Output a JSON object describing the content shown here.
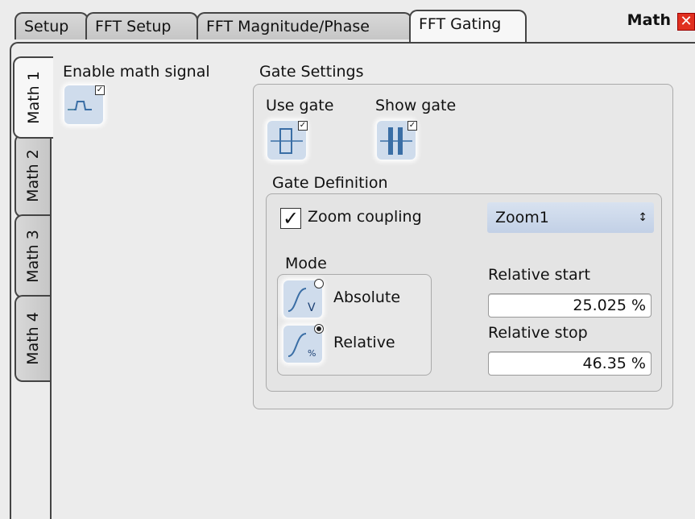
{
  "header": {
    "tabs": [
      {
        "label": "Setup"
      },
      {
        "label": "FFT Setup"
      },
      {
        "label": "FFT Magnitude/Phase"
      },
      {
        "label": "FFT Gating"
      }
    ],
    "title": "Math",
    "close_glyph": "✕"
  },
  "side_tabs": [
    {
      "label": "Math 1"
    },
    {
      "label": "Math 2"
    },
    {
      "label": "Math 3"
    },
    {
      "label": "Math 4"
    }
  ],
  "enable_math": {
    "label": "Enable math signal",
    "checked": true
  },
  "gate_settings": {
    "label": "Gate Settings",
    "use_gate": {
      "label": "Use gate",
      "checked": true
    },
    "show_gate": {
      "label": "Show gate",
      "checked": true
    }
  },
  "gate_definition": {
    "label": "Gate Definition",
    "zoom_coupling": {
      "label": "Zoom coupling",
      "checked": true
    },
    "zoom_select": {
      "value": "Zoom1"
    },
    "mode": {
      "label": "Mode",
      "options": [
        {
          "label": "Absolute",
          "icon_text": "V",
          "selected": false
        },
        {
          "label": "Relative",
          "icon_text": "%",
          "selected": true
        }
      ]
    },
    "relative_start": {
      "label": "Relative start",
      "value": "25.025 %"
    },
    "relative_stop": {
      "label": "Relative stop",
      "value": "46.35 %"
    }
  },
  "colors": {
    "accent": "#c8d6ea",
    "close": "#e03020"
  }
}
